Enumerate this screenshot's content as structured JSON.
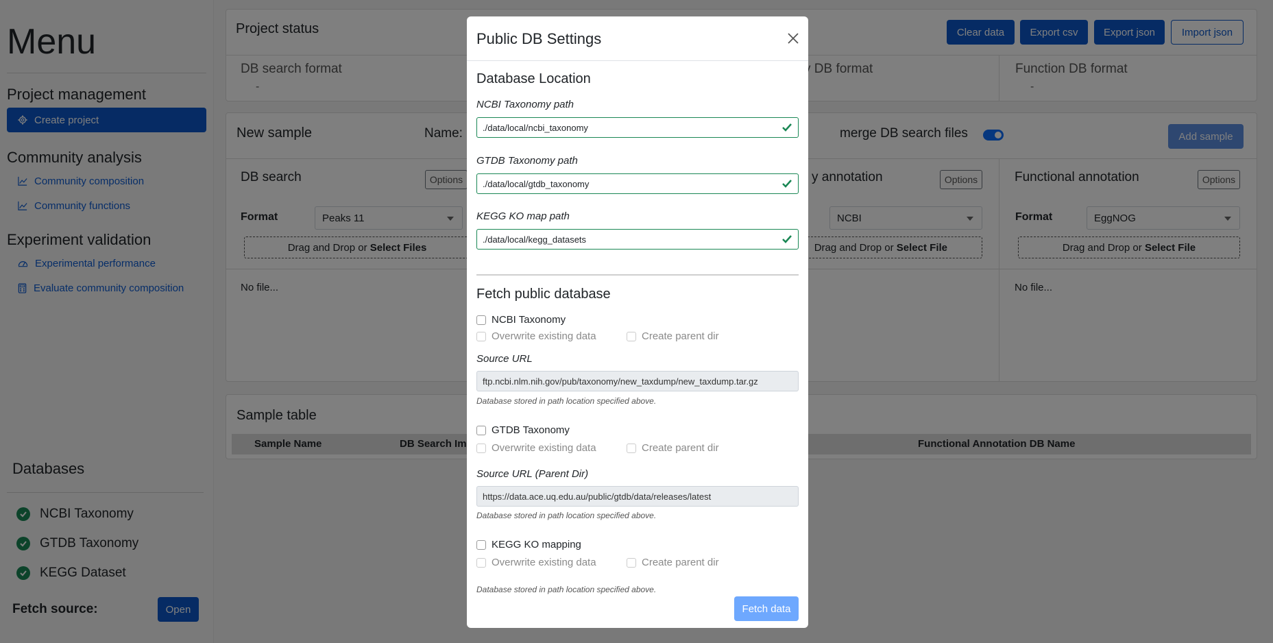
{
  "sidebar": {
    "title": "Menu",
    "sections": [
      {
        "title": "Project management",
        "items": [
          {
            "label": "Create project",
            "icon": "gear-icon",
            "active": true
          }
        ]
      },
      {
        "title": "Community analysis",
        "items": [
          {
            "label": "Community composition",
            "icon": "line-chart-icon"
          },
          {
            "label": "Community functions",
            "icon": "line-chart-icon"
          }
        ]
      },
      {
        "title": "Experiment validation",
        "items": [
          {
            "label": "Experimental performance",
            "icon": "speedometer-icon"
          },
          {
            "label": "Evaluate community composition",
            "icon": "calculator-icon"
          }
        ]
      }
    ],
    "databases_title": "Databases",
    "databases": [
      {
        "label": "NCBI Taxonomy"
      },
      {
        "label": "GTDB Taxonomy"
      },
      {
        "label": "KEGG Dataset"
      }
    ],
    "fetch_source_label": "Fetch source:",
    "open_label": "Open"
  },
  "project_status": {
    "title": "Project status",
    "buttons": {
      "clear": "Clear data",
      "export_csv": "Export csv",
      "export_json": "Export json",
      "import_json": "Import json"
    },
    "db_search_format_label": "DB search format",
    "db_search_format_value": "-",
    "taxonomy_db_format_label": "y DB format",
    "function_db_format_label": "Function DB format",
    "function_db_format_value": "-"
  },
  "new_sample": {
    "title": "New sample",
    "name_label": "Name:",
    "merge_label": "merge DB search files",
    "add_sample": "Add sample",
    "db_search": {
      "title": "DB search",
      "options": "Options",
      "format_label": "Format",
      "format_value": "Peaks 11",
      "drop_text": "Drag and Drop or ",
      "drop_link": "Select Files",
      "no_file": "No file..."
    },
    "taxonomy": {
      "title": "y annotation",
      "options": "Options",
      "format_value": "NCBI",
      "drop_text": "Drag and Drop or ",
      "drop_link": "Select File"
    },
    "functional": {
      "title": "Functional annotation",
      "options": "Options",
      "format_label": "Format",
      "format_value": "EggNOG",
      "drop_text": "Drag and Drop or ",
      "drop_link": "Select File",
      "no_file": "No file..."
    }
  },
  "sample_table": {
    "title": "Sample table",
    "columns": [
      "Sample Name",
      "DB Search Im",
      "Functional Annotation DB Name"
    ]
  },
  "modal": {
    "title": "Public DB Settings",
    "location_heading": "Database Location",
    "ncbi_path_label": "NCBI Taxonomy path",
    "ncbi_path_value": "./data/local/ncbi_taxonomy",
    "gtdb_path_label": "GTDB Taxonomy path",
    "gtdb_path_value": "./data/local/gtdb_taxonomy",
    "kegg_path_label": "KEGG KO map path",
    "kegg_path_value": "./data/local/kegg_datasets",
    "fetch_heading": "Fetch public database",
    "ncbi_cb": "NCBI Taxonomy",
    "overwrite": "Overwrite existing data",
    "create_parent": "Create parent dir",
    "source_url_label": "Source URL",
    "ncbi_url": "ftp.ncbi.nlm.nih.gov/pub/taxonomy/new_taxdump/new_taxdump.tar.gz",
    "hint": "Database stored in path location specified above.",
    "gtdb_cb": "GTDB Taxonomy",
    "source_url_parent_label": "Source URL (Parent Dir)",
    "gtdb_url": "https://data.ace.uq.edu.au/public/gtdb/data/releases/latest",
    "kegg_cb": "KEGG KO mapping",
    "fetch_button": "Fetch data"
  },
  "colors": {
    "primary": "#0d57c8",
    "success": "#198754",
    "fetch_disabled": "#6ea8fe"
  }
}
